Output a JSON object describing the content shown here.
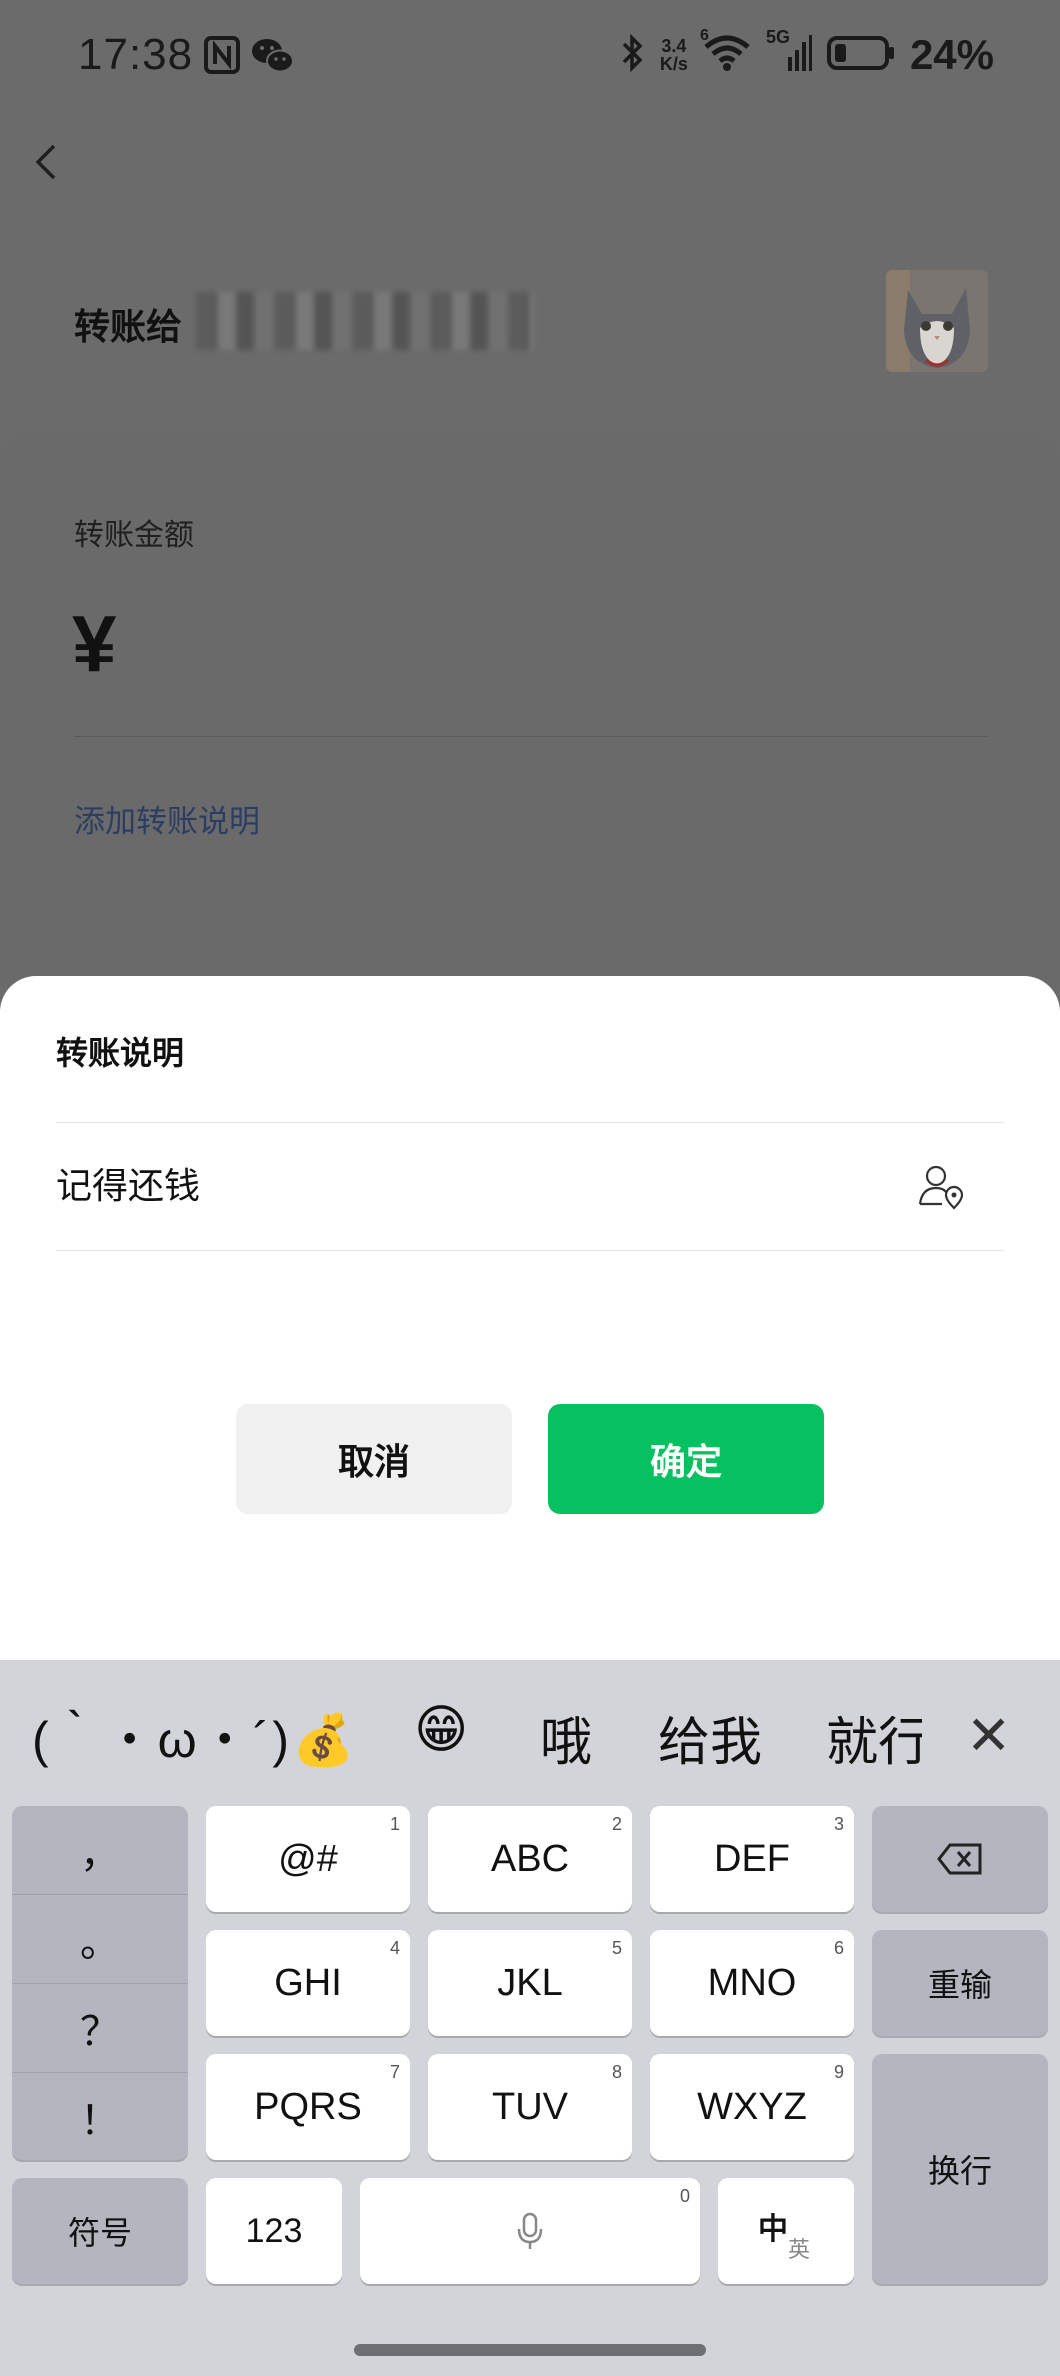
{
  "status_bar": {
    "time": "17:38",
    "speed_value": "3.4",
    "speed_unit": "K/s",
    "network": "5G",
    "wifi_label": "6",
    "battery_percent": "24%",
    "battery_level": 0.24
  },
  "header": {
    "title_prefix": "转账给"
  },
  "transfer": {
    "amount_label": "转账金额",
    "currency_symbol": "¥",
    "add_note_link": "添加转账说明"
  },
  "dialog": {
    "title": "转账说明",
    "note_value": "记得还钱",
    "cancel_label": "取消",
    "confirm_label": "确定",
    "confirm_color": "#07c160"
  },
  "keyboard": {
    "candidates": [
      "(｀・ω・´)💰",
      "😁",
      "哦",
      "给我",
      "就行"
    ],
    "close_symbol": "✕",
    "punctuation": [
      "，",
      "。",
      "？",
      "！"
    ],
    "keys": [
      {
        "label": "@#",
        "num": "1"
      },
      {
        "label": "ABC",
        "num": "2"
      },
      {
        "label": "DEF",
        "num": "3"
      },
      {
        "label": "GHI",
        "num": "4"
      },
      {
        "label": "JKL",
        "num": "5"
      },
      {
        "label": "MNO",
        "num": "6"
      },
      {
        "label": "PQRS",
        "num": "7"
      },
      {
        "label": "TUV",
        "num": "8"
      },
      {
        "label": "WXYZ",
        "num": "9"
      }
    ],
    "reenter_label": "重输",
    "newline_label": "换行",
    "symbol_label": "符号",
    "numeric_label": "123",
    "space_num": "0",
    "lang_primary": "中",
    "lang_secondary": "英"
  }
}
